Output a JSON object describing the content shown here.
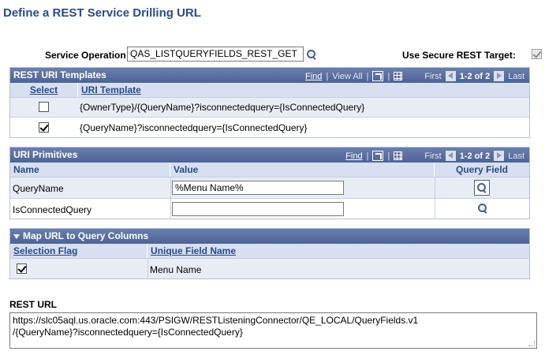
{
  "page_title": "Define a REST Service Drilling URL",
  "service_operation": {
    "label": "Service Operation",
    "value": "QAS_LISTQUERYFIELDS_REST_GET"
  },
  "secure_target": {
    "label": "Use Secure REST Target:",
    "checked": true
  },
  "uri_templates": {
    "title": "REST URI Templates",
    "nav": {
      "find": "Find",
      "view_all": "View All",
      "first": "First",
      "range": "1-2 of 2",
      "last": "Last"
    },
    "columns": {
      "select": "Select",
      "uri_template": "URI Template"
    },
    "rows": [
      {
        "checked": false,
        "template": "{OwnerType}/{QueryName}?isconnectedquery={IsConnectedQuery}"
      },
      {
        "checked": true,
        "template": "{QueryName}?isconnectedquery={IsConnectedQuery}"
      }
    ]
  },
  "uri_primitives": {
    "title": "URI Primitives",
    "nav": {
      "find": "Find",
      "first": "First",
      "range": "1-2 of 2",
      "last": "Last"
    },
    "columns": {
      "name": "Name",
      "value": "Value",
      "query_field": "Query Field"
    },
    "rows": [
      {
        "name": "QueryName",
        "value": "%Menu Name%"
      },
      {
        "name": "IsConnectedQuery",
        "value": ""
      }
    ]
  },
  "map_url": {
    "title": "Map URL to Query Columns",
    "columns": {
      "selection_flag": "Selection Flag",
      "unique_field_name": "Unique Field Name"
    },
    "rows": [
      {
        "checked": true,
        "field_name": "Menu Name"
      }
    ]
  },
  "rest_url": {
    "label": "REST URL",
    "line1": "https://slc05aql.us.oracle.com:443/PSIGW/RESTListeningConnector/QE_LOCAL/QueryFields.v1",
    "line2": "/{QueryName}?isconnectedquery={IsConnectedQuery}"
  },
  "colors": {
    "header": "#4d6395",
    "title": "#2b4a8a",
    "alt_row": "#e8ecf5"
  }
}
